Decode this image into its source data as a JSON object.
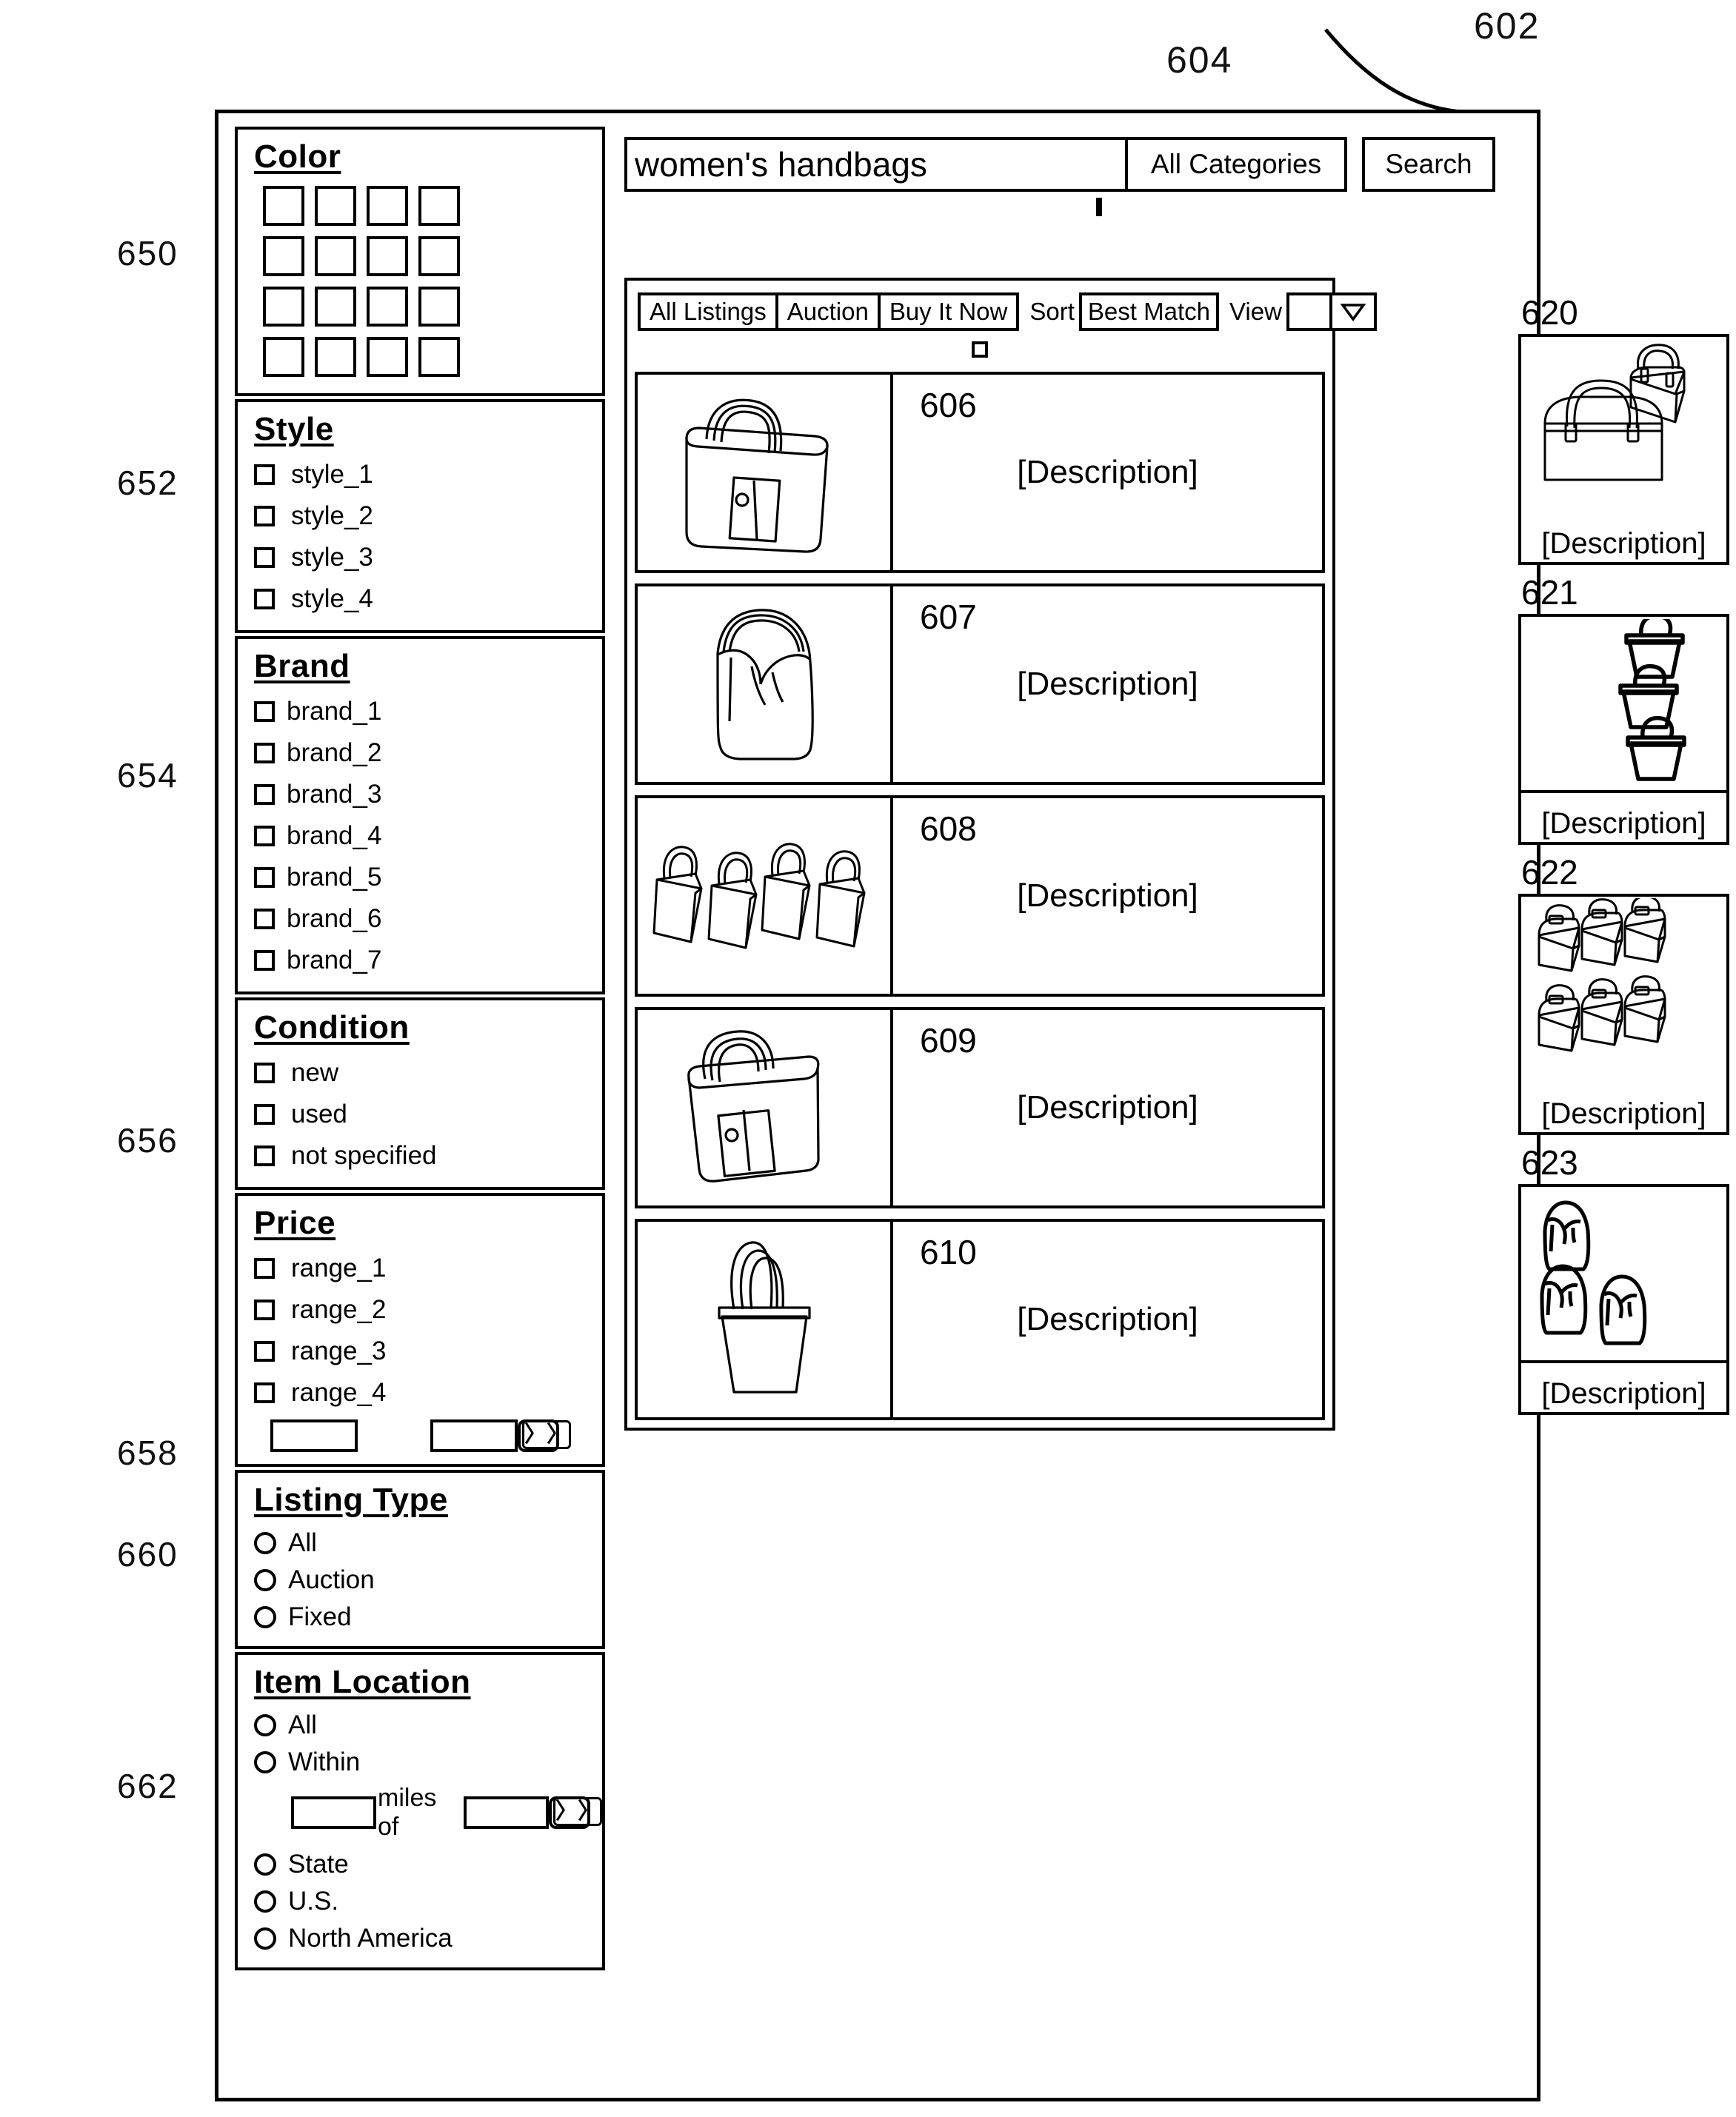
{
  "figure": {
    "callouts": [
      {
        "id": "602",
        "target": "application-frame"
      },
      {
        "id": "604",
        "target": "search-input"
      }
    ],
    "left_refs": [
      {
        "id": "650",
        "target": "color-filter"
      },
      {
        "id": "652",
        "target": "style-filter"
      },
      {
        "id": "654",
        "target": "brand-filter"
      },
      {
        "id": "656",
        "target": "condition-filter"
      },
      {
        "id": "658",
        "target": "price-filter"
      },
      {
        "id": "660",
        "target": "listing-type-filter"
      },
      {
        "id": "662",
        "target": "item-location-filter"
      }
    ]
  },
  "search": {
    "query": "women's handbags",
    "placeholder": "women's handbags",
    "category": "All Categories",
    "button": "Search"
  },
  "toolbar": {
    "tabs": [
      "All Listings",
      "Auction",
      "Buy It Now"
    ],
    "sort_label": "Sort",
    "sort_value": "Best Match",
    "view_label": "View",
    "view_value": "",
    "caret_icon": "▽"
  },
  "filters": [
    {
      "key": "color",
      "title": "Color",
      "control": "swatches",
      "swatch_count": 16
    },
    {
      "key": "style",
      "title": "Style",
      "control": "checkbox",
      "options": [
        "style_1",
        "style_2",
        "style_3",
        "style_4"
      ]
    },
    {
      "key": "brand",
      "title": "Brand",
      "control": "checkbox",
      "options": [
        "brand_1",
        "brand_2",
        "brand_3",
        "brand_4",
        "brand_5",
        "brand_6",
        "brand_7"
      ]
    },
    {
      "key": "condition",
      "title": "Condition",
      "control": "checkbox",
      "options": [
        "new",
        "used",
        "not specified"
      ]
    },
    {
      "key": "price",
      "title": "Price",
      "control": "checkbox",
      "options": [
        "range_1",
        "range_2",
        "range_3",
        "range_4"
      ],
      "min_value": "",
      "max_value": "",
      "go_icon": "〉〉"
    },
    {
      "key": "listing_type",
      "title": "Listing Type",
      "control": "radio",
      "options": [
        "All",
        "Auction",
        "Fixed"
      ]
    },
    {
      "key": "item_location",
      "title": "Item Location",
      "control": "radio",
      "options": [
        "All",
        "Within",
        "State",
        "U.S.",
        "North America"
      ],
      "distance_value": "",
      "miles_label": "miles of",
      "place_value": "",
      "go_icon": "〉〉"
    }
  ],
  "listings": [
    {
      "num": "606",
      "description": "[Description]",
      "art": "tote-bag"
    },
    {
      "num": "607",
      "description": "[Description]",
      "art": "hobo-bag"
    },
    {
      "num": "608",
      "description": "[Description]",
      "art": "four-handbags"
    },
    {
      "num": "609",
      "description": "[Description]",
      "art": "tote-bag"
    },
    {
      "num": "610",
      "description": "[Description]",
      "art": "bucket-bag"
    }
  ],
  "recommendations": [
    {
      "num": "620",
      "description": "[Description]",
      "art": "duffle-and-satchel"
    },
    {
      "num": "621",
      "description": "[Description]",
      "art": "three-bucket-bags"
    },
    {
      "num": "622",
      "description": "[Description]",
      "art": "six-satchels"
    },
    {
      "num": "623",
      "description": "[Description]",
      "art": "three-hobo-bags"
    }
  ],
  "colors": {
    "line": "#000000",
    "background": "#ffffff"
  }
}
